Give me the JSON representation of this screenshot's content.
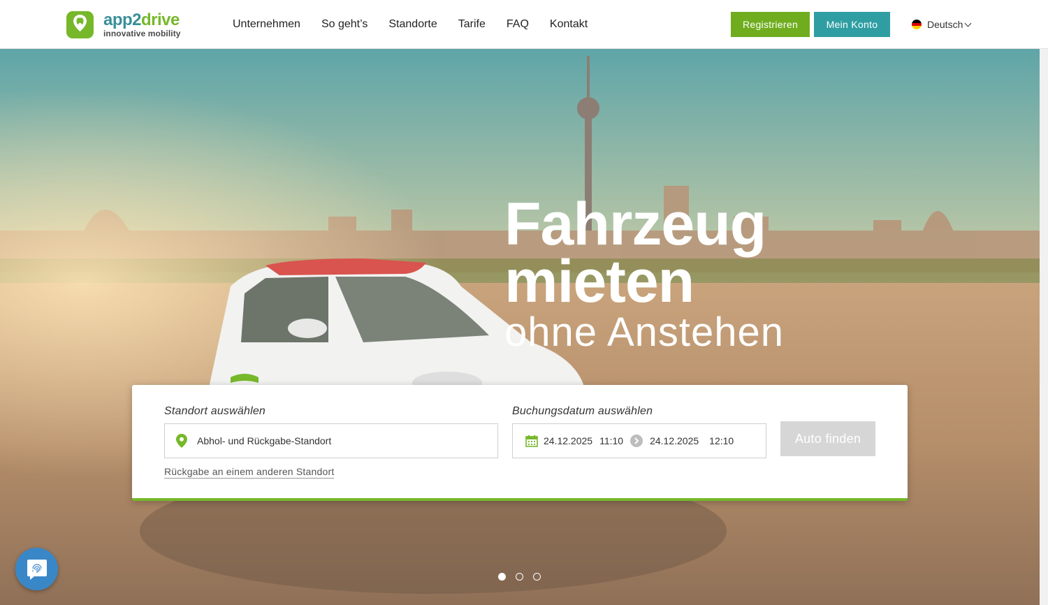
{
  "header": {
    "logo": {
      "title_part1": "app2",
      "title_part2": "drive",
      "subtitle": "innovative mobility"
    },
    "nav": [
      "Unternehmen",
      "So geht’s",
      "Standorte",
      "Tarife",
      "FAQ",
      "Kontakt"
    ],
    "register_label": "Registrieren",
    "account_label": "Mein Konto",
    "language": "Deutsch"
  },
  "hero": {
    "headline_line1": "Fahrzeug",
    "headline_line2": "mieten",
    "subheadline": "ohne Anstehen"
  },
  "search": {
    "location_label": "Standort auswählen",
    "location_value": "Abhol- und Rückgabe-Standort",
    "return_link": "Rückgabe an einem anderen Standort",
    "date_label": "Buchungsdatum auswählen",
    "start_date": "24.12.2025",
    "start_time": "11:10",
    "end_date": "24.12.2025",
    "end_time": "12:10",
    "submit_label": "Auto finden"
  },
  "slider": {
    "count": 3,
    "active_index": 0
  },
  "colors": {
    "green": "#76b82a",
    "teal": "#2f9ea3",
    "chat_blue": "#3a87c8"
  },
  "icons": [
    "logo-pin-icon",
    "location-pin-icon",
    "calendar-icon",
    "arrow-right-icon",
    "chevron-down-icon",
    "fingerprint-chat-icon"
  ]
}
